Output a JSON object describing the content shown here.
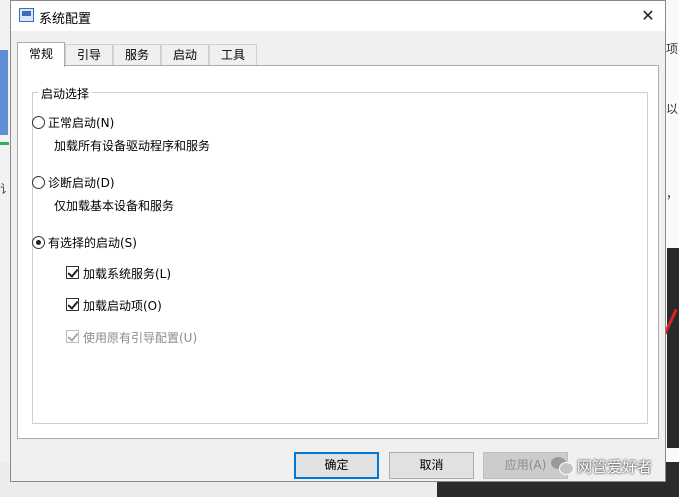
{
  "window": {
    "title": "系统配置",
    "close_glyph": "✕"
  },
  "tabs": [
    {
      "label": "常规",
      "active": true
    },
    {
      "label": "引导",
      "active": false
    },
    {
      "label": "服务",
      "active": false
    },
    {
      "label": "启动",
      "active": false
    },
    {
      "label": "工具",
      "active": false
    }
  ],
  "startup": {
    "group_title": "启动选择",
    "options": [
      {
        "label": "正常启动(N)",
        "desc": "加载所有设备驱动程序和服务",
        "checked": false
      },
      {
        "label": "诊断启动(D)",
        "desc": "仅加载基本设备和服务",
        "checked": false
      },
      {
        "label": "有选择的启动(S)",
        "checked": true
      }
    ],
    "selective": [
      {
        "label": "加载系统服务(L)",
        "checked": true,
        "enabled": true
      },
      {
        "label": "加载启动项(O)",
        "checked": true,
        "enabled": true
      },
      {
        "label": "使用原有引导配置(U)",
        "checked": true,
        "enabled": false
      }
    ]
  },
  "buttons": {
    "ok": "确定",
    "cancel": "取消",
    "apply": "应用(A)"
  },
  "watermark": "网管爱好者",
  "background": {
    "left_glyph": "讠",
    "right_glyphs": [
      "项",
      "以",
      "，"
    ]
  },
  "colors": {
    "accent": "#0078d7",
    "panel_bg": "#ffffff",
    "dialog_bg": "#f0f0f0"
  }
}
